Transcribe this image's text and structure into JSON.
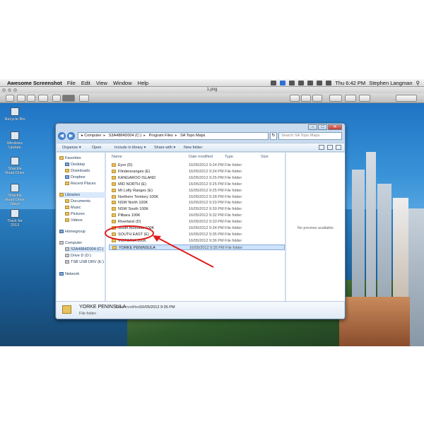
{
  "menubar": {
    "apple": "",
    "app_name": "Awesome Screenshot",
    "items": [
      "File",
      "Edit",
      "View",
      "Window",
      "Help"
    ],
    "clock": "Thu 6:42 PM",
    "user": "Stephen Langman"
  },
  "viewer": {
    "title": "1.png"
  },
  "desktop_icons": [
    {
      "label": "Recycle Bin"
    },
    {
      "label": "Windows Update"
    },
    {
      "label": "Shackle Road Drive"
    },
    {
      "label": "Shackle Road Drive Wave"
    },
    {
      "label": "Track for 2013"
    }
  ],
  "explorer": {
    "caption": {
      "minimize": "–",
      "maximize": "□",
      "close": "✕"
    },
    "address": {
      "crumbs": [
        "Computer",
        "S3A4884D004 (C:)",
        "Program Files",
        "SA Topo Maps"
      ]
    },
    "search": {
      "placeholder": "Search SA Topo Maps"
    },
    "commands": [
      "Organize ▾",
      "Open",
      "Include in library ▾",
      "Share with ▾",
      "New folder"
    ],
    "nav": {
      "favorites": "Favorites",
      "fav_items": [
        "Desktop",
        "Downloads",
        "Dropbox",
        "Recent Places"
      ],
      "libraries": "Libraries",
      "lib_items": [
        "Documents",
        "Music",
        "Pictures",
        "Videos"
      ],
      "homegroup": "Homegroup",
      "computer": "Computer",
      "drives": [
        "S3A4884D004 (C:)",
        "Drive D (D:)",
        "TSB USB DRV (E:)"
      ],
      "network": "Network"
    },
    "columns": {
      "name": "Name",
      "date": "Date modified",
      "type": "Type",
      "size": "Size"
    },
    "files": [
      {
        "name": "Eyre (D)",
        "date": "16/05/2012 9:24 PM",
        "type": "File folder"
      },
      {
        "name": "Flindersranges (E)",
        "date": "16/05/2012 9:24 PM",
        "type": "File folder"
      },
      {
        "name": "KANGAROO ISLAND",
        "date": "16/05/2012 9:25 PM",
        "type": "File folder"
      },
      {
        "name": "MID NORTH (E)",
        "date": "16/05/2012 9:25 PM",
        "type": "File folder"
      },
      {
        "name": "Mt Lofty Ranges (E)",
        "date": "16/05/2012 9:25 PM",
        "type": "File folder"
      },
      {
        "name": "Northern Territory 100K",
        "date": "16/05/2012 9:28 PM",
        "type": "File folder"
      },
      {
        "name": "NSW North 100K",
        "date": "16/05/2012 9:29 PM",
        "type": "File folder"
      },
      {
        "name": "NSW South 100K",
        "date": "16/05/2012 9:30 PM",
        "type": "File folder"
      },
      {
        "name": "Pilbara 100K",
        "date": "16/05/2012 9:32 PM",
        "type": "File folder"
      },
      {
        "name": "Riverland (D)",
        "date": "16/05/2012 9:33 PM",
        "type": "File folder"
      },
      {
        "name": "South Australia 100K",
        "date": "16/05/2012 9:34 PM",
        "type": "File folder"
      },
      {
        "name": "SOUTH EAST (E)",
        "date": "16/05/2012 9:35 PM",
        "type": "File folder"
      },
      {
        "name": "VICTORIA 100K",
        "date": "16/05/2012 9:36 PM",
        "type": "File folder"
      },
      {
        "name": "YORKE PENINSULA",
        "date": "16/05/2012 9:35 PM",
        "type": "File folder"
      }
    ],
    "selected_index": 13,
    "preview": "No preview available.",
    "details": {
      "name": "YORKE PENINSULA",
      "date_label": "Date modified:",
      "date_value": "16/05/2012 9:35 PM",
      "kind": "File folder"
    }
  },
  "annotation_color": "#e01b1b"
}
